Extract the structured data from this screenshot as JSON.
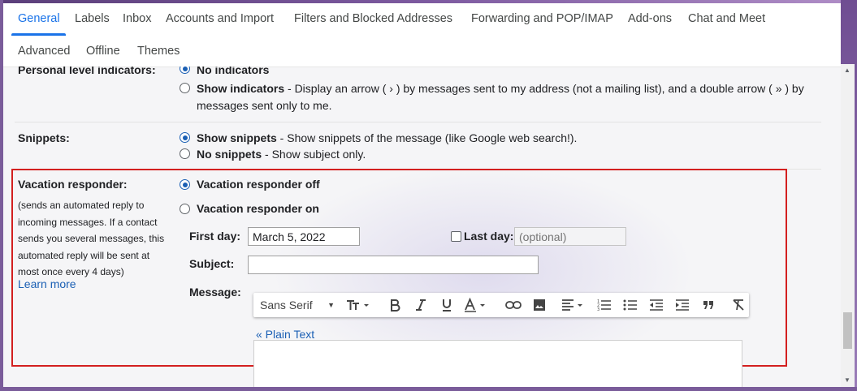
{
  "tabs": [
    "General",
    "Labels",
    "Inbox",
    "Accounts and Import",
    "Filters and Blocked Addresses",
    "Forwarding and POP/IMAP",
    "Add-ons",
    "Chat and Meet",
    "Advanced",
    "Offline",
    "Themes"
  ],
  "personal_level": {
    "label": "Personal level indicators:",
    "option1": "No indicators",
    "option2_title": "Show indicators",
    "option2_desc_line1": " - Display an arrow ( › ) by messages sent to my address (not a mailing list), and a double arrow ( » ) by",
    "option2_desc_line2": "messages sent only to me."
  },
  "snippets": {
    "label": "Snippets:",
    "option1_title": "Show snippets",
    "option1_desc": " - Show snippets of the message (like Google web search!).",
    "option2_title": "No snippets",
    "option2_desc": " - Show subject only."
  },
  "vacation": {
    "label": "Vacation responder:",
    "desc_lines": [
      "(sends an automated reply to",
      "incoming messages. If a contact",
      "sends you several messages, this",
      "automated reply will be sent at",
      "most once every 4 days)"
    ],
    "learn_more": "Learn more",
    "off_label": "Vacation responder off",
    "on_label": "Vacation responder on",
    "first_day_label": "First day:",
    "first_day_value": "March 5, 2022",
    "last_day_label": "Last day:",
    "last_day_placeholder": "(optional)",
    "subject_label": "Subject:",
    "subject_value": "",
    "message_label": "Message:",
    "font_select": "Sans Serif",
    "plain_text_link": "« Plain Text"
  }
}
